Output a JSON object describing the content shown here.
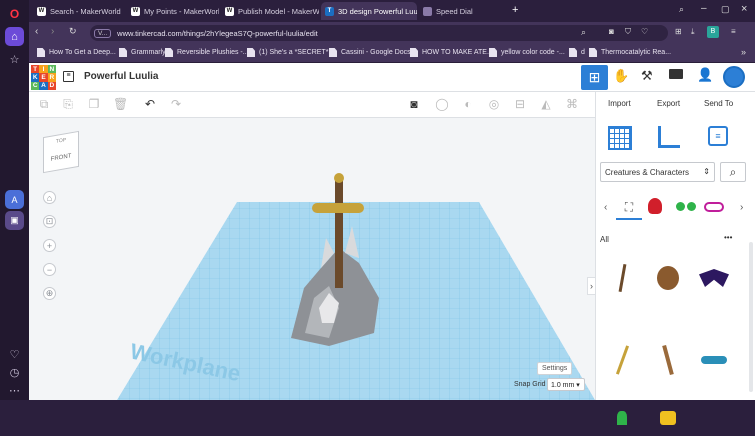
{
  "browser": {
    "tabs": [
      {
        "label": "Search - MakerWorld",
        "favicon": "W"
      },
      {
        "label": "My Points - MakerWorld",
        "favicon": "W"
      },
      {
        "label": "Publish Model - MakerWo",
        "favicon": "W"
      },
      {
        "label": "3D design Powerful Luulia",
        "favicon": "T"
      },
      {
        "label": "Speed Dial",
        "favicon": ""
      }
    ],
    "url": "www.tinkercad.com/things/2hYlegeaS7Q-powerful-luulia/edit",
    "url_badge": "V...",
    "bookmarks": [
      "How To Get a Deep...",
      "Grammarly",
      "Reversible Plushies -...",
      "(1) She's a *SECRET*...",
      "Cassini - Google Docs",
      "HOW TO MAKE ATE...",
      "yellow color code -...",
      "d",
      "Thermocatalytic Rea..."
    ]
  },
  "tinkercad": {
    "logo_letters": [
      "TIN",
      "KER",
      "CAD"
    ],
    "logo_colors": [
      "#e8462a",
      "#f8a21c",
      "#5cb85c",
      "#1b6ec2",
      "#e8462a",
      "#f8a21c",
      "#5cb85c",
      "#1b6ec2",
      "#e8462a"
    ],
    "design_title": "Powerful Luulia",
    "actions": {
      "import": "Import",
      "export": "Export",
      "send_to": "Send To"
    },
    "shape_category": "Creatures & Characters",
    "filter_all": "All",
    "more": "•••",
    "viewcube": {
      "top": "TOP",
      "front": "FRONT"
    },
    "workplane_label": "Workplane",
    "settings_label": "Settings",
    "snap_grid_label": "Snap Grid",
    "snap_grid_value": "1.0 mm"
  },
  "colors": {
    "accent": "#2c7fd6",
    "browser_bg": "#2b1f3d",
    "workplane": "#a9d8f0",
    "grid_line": "#7cc3e6"
  }
}
